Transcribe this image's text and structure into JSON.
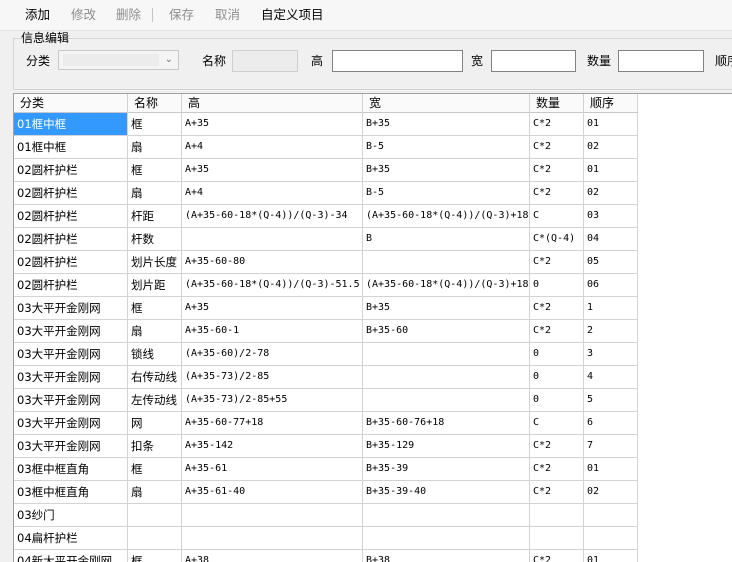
{
  "toolbar": {
    "add": "添加",
    "edit": "修改",
    "delete": "删除",
    "save": "保存",
    "cancel": "取消",
    "custom": "自定义项目"
  },
  "form": {
    "group_title": "信息编辑",
    "category_label": "分类",
    "category_value": "",
    "name_label": "名称",
    "name_value": "",
    "height_label": "高",
    "height_value": "",
    "width_label": "宽",
    "width_value": "",
    "qty_label": "数量",
    "qty_value": "",
    "order_label": "顺序"
  },
  "table": {
    "columns": [
      "分类",
      "名称",
      "高",
      "宽",
      "数量",
      "顺序"
    ],
    "rows": [
      [
        "01框中框",
        "框",
        "A+35",
        "B+35",
        "C*2",
        "01"
      ],
      [
        "01框中框",
        "扇",
        "A+4",
        "B-5",
        "C*2",
        "02"
      ],
      [
        "02圆杆护栏",
        "框",
        "A+35",
        "B+35",
        "C*2",
        "01"
      ],
      [
        "02圆杆护栏",
        "扇",
        "A+4",
        "B-5",
        "C*2",
        "02"
      ],
      [
        "02圆杆护栏",
        "杆距",
        "(A+35-60-18*(Q-4))/(Q-3)-34",
        "(A+35-60-18*(Q-4))/(Q-3)+18",
        "C",
        "03"
      ],
      [
        "02圆杆护栏",
        "杆数",
        "",
        "B",
        "C*(Q-4)",
        "04"
      ],
      [
        "02圆杆护栏",
        "划片长度",
        "A+35-60-80",
        "",
        "C*2",
        "05"
      ],
      [
        "02圆杆护栏",
        "划片距",
        "(A+35-60-18*(Q-4))/(Q-3)-51.5",
        "(A+35-60-18*(Q-4))/(Q-3)+18",
        "0",
        "06"
      ],
      [
        "03大平开金刚网",
        "框",
        "A+35",
        "B+35",
        "C*2",
        "1"
      ],
      [
        "03大平开金刚网",
        "扇",
        "A+35-60-1",
        "B+35-60",
        "C*2",
        "2"
      ],
      [
        "03大平开金刚网",
        "锁线",
        "(A+35-60)/2-78",
        "",
        "0",
        "3"
      ],
      [
        "03大平开金刚网",
        "右传动线",
        "(A+35-73)/2-85",
        "",
        "0",
        "4"
      ],
      [
        "03大平开金刚网",
        "左传动线",
        "(A+35-73)/2-85+55",
        "",
        "0",
        "5"
      ],
      [
        "03大平开金刚网",
        "网",
        "A+35-60-77+18",
        "B+35-60-76+18",
        "C",
        "6"
      ],
      [
        "03大平开金刚网",
        "扣条",
        "A+35-142",
        "B+35-129",
        "C*2",
        "7"
      ],
      [
        "03框中框直角",
        "框",
        "A+35-61",
        "B+35-39",
        "C*2",
        "01"
      ],
      [
        "03框中框直角",
        "扇",
        "A+35-61-40",
        "B+35-39-40",
        "C*2",
        "02"
      ],
      [
        "03纱门",
        "",
        "",
        "",
        "",
        ""
      ],
      [
        "04扁杆护栏",
        "",
        "",
        "",
        "",
        ""
      ],
      [
        "04新大平开金刚网",
        "框",
        "A+38",
        "B+38",
        "C*2",
        "01"
      ]
    ]
  }
}
